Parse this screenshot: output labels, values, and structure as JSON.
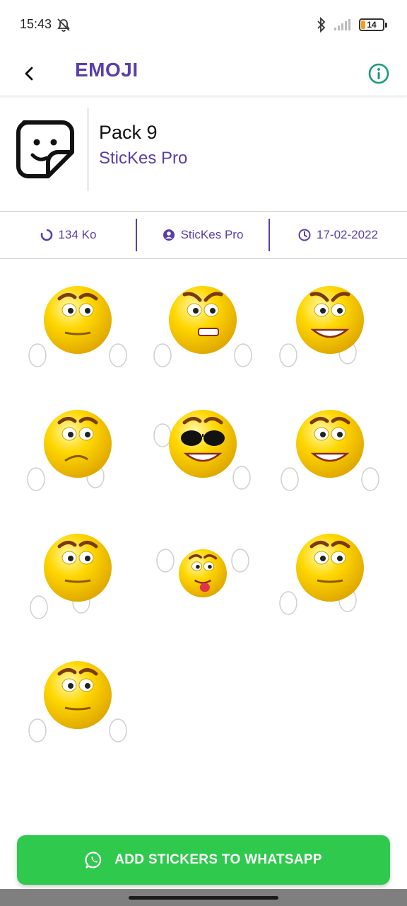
{
  "status_bar": {
    "time": "15:43",
    "battery_level": "14",
    "icons": [
      "mute-icon",
      "bluetooth-icon",
      "signal-icon",
      "battery-icon"
    ]
  },
  "app_bar": {
    "title": "EMOJI",
    "back_icon": "back-arrow-icon",
    "info_icon": "info-icon"
  },
  "pack": {
    "name": "Pack 9",
    "author": "SticKes Pro"
  },
  "info": {
    "size": "134 Ko",
    "author": "SticKes Pro",
    "date": "17-02-2022"
  },
  "stickers": [
    {
      "expression": "neutral",
      "hands": "down"
    },
    {
      "expression": "angry-grit",
      "hands": "down"
    },
    {
      "expression": "angry-teeth",
      "hands": "chin"
    },
    {
      "expression": "worried",
      "hands": "chin"
    },
    {
      "expression": "sunglasses",
      "hands": "wave"
    },
    {
      "expression": "big-smile",
      "hands": "down"
    },
    {
      "expression": "shh",
      "hands": "mouth"
    },
    {
      "expression": "tongue",
      "hands": "up"
    },
    {
      "expression": "thinking",
      "hands": "chin"
    },
    {
      "expression": "smirk",
      "hands": "down"
    }
  ],
  "add_button": {
    "label": "ADD STICKERS TO WHATSAPP",
    "icon": "whatsapp-icon"
  },
  "colors": {
    "accent": "#5a3fa8",
    "button": "#2fc94d",
    "info_icon": "#1a9a7e",
    "emoji_yellow": "#ffd700"
  }
}
